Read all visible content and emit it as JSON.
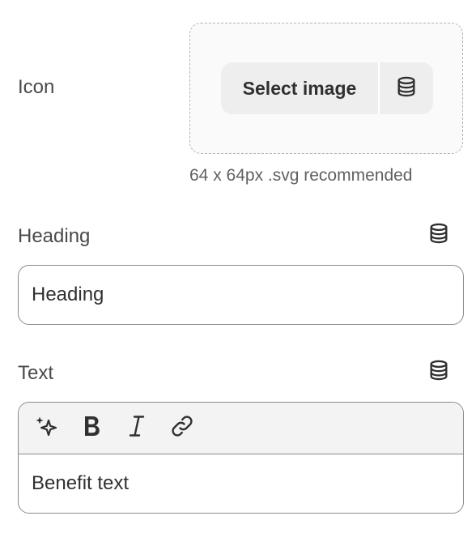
{
  "icon_field": {
    "label": "Icon",
    "select_button_label": "Select image",
    "source_icon": "database-icon",
    "hint": "64 x 64px .svg recommended"
  },
  "heading_field": {
    "label": "Heading",
    "source_icon": "database-icon",
    "value": "Heading"
  },
  "text_field": {
    "label": "Text",
    "source_icon": "database-icon",
    "toolbar": [
      "magic-sparkle-icon",
      "bold-icon",
      "italic-icon",
      "link-icon"
    ],
    "value": "Benefit text"
  },
  "colors": {
    "text": "#303030",
    "label": "#4a4a4a",
    "border": "#8a8a8a",
    "button_bg": "#eeeeee",
    "toolbar_bg": "#f3f3f3"
  }
}
